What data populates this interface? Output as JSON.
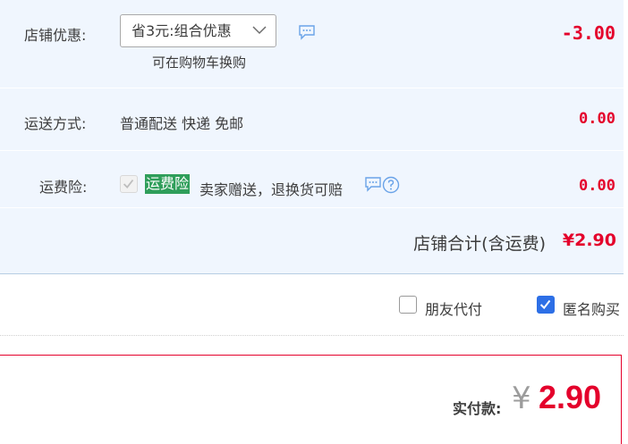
{
  "shop_discount": {
    "label": "店铺优惠:",
    "select_value": "省3元:组合优惠",
    "note": "可在购物车换购",
    "amount": "-3.00"
  },
  "shipping": {
    "label": "运送方式:",
    "method": "普通配送 快递 免邮",
    "amount": "0.00"
  },
  "insurance": {
    "label": "运费险:",
    "tag": "运费险",
    "desc": "卖家赠送，退换货可赔",
    "amount": "0.00"
  },
  "shop_total": {
    "label": "店铺合计(含运费)",
    "amount": "¥2.90"
  },
  "options": {
    "friend_pay": "朋友代付",
    "anonymous": "匿名购买"
  },
  "payment": {
    "label": "实付款:",
    "currency": "¥",
    "amount": "2.90"
  },
  "colors": {
    "accent_red": "#e4002b",
    "panel_bg": "#f0f6fe",
    "checkbox_blue": "#2d6fe6",
    "tag_green": "#2f9e5a"
  }
}
